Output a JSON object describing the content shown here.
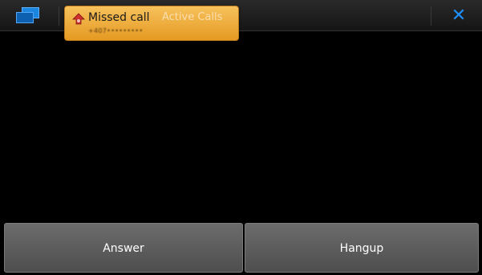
{
  "window": {
    "title": "Active Calls"
  },
  "icons": {
    "task_switcher": "task-switcher-icon",
    "close": "close-icon",
    "missed_call": "missed-call-icon"
  },
  "notification": {
    "title": "Missed call",
    "number": "+407•••••••••",
    "bg_color": "#f0ae3a"
  },
  "actions": {
    "answer_label": "Answer",
    "hangup_label": "Hangup"
  },
  "colors": {
    "accent": "#1e90ff",
    "missed_call_red": "#d0312d"
  }
}
